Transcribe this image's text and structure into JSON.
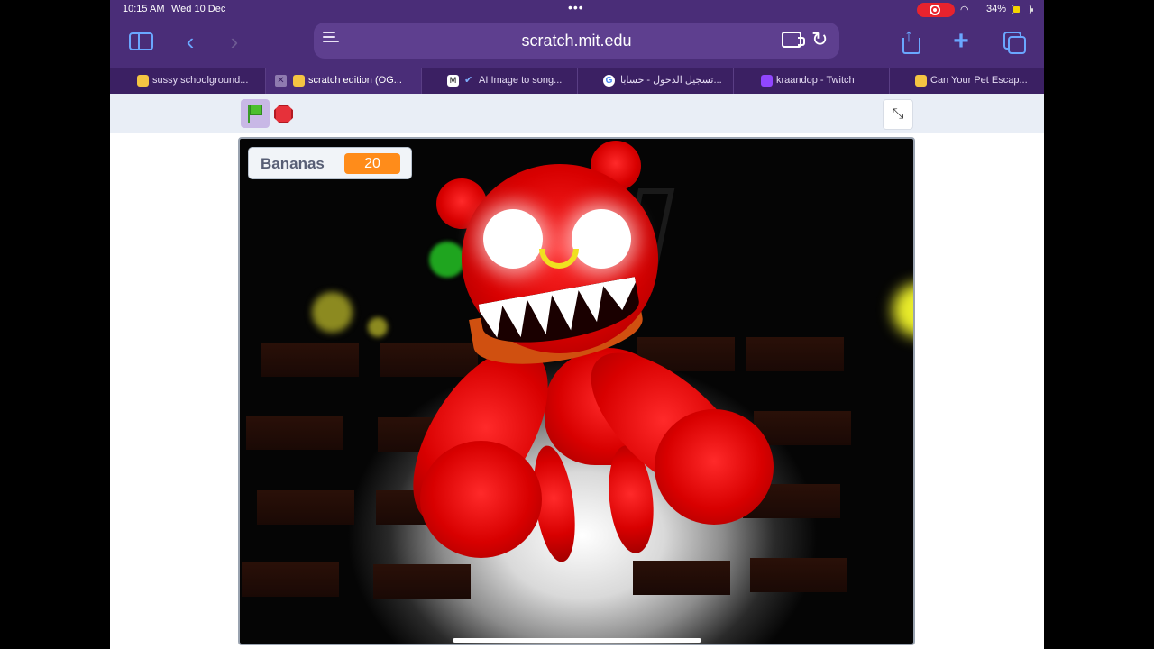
{
  "status_bar": {
    "time": "10:15 AM",
    "date": "Wed 10 Dec",
    "battery_percent": "34%",
    "battery_level": 0.34,
    "recording": true
  },
  "browser": {
    "url": "scratch.mit.edu",
    "tabs": [
      {
        "label": "sussy schoolground...",
        "active": false,
        "favicon_color": "#f5c542"
      },
      {
        "label": "scratch edition (OG...",
        "active": true,
        "favicon_color": "#f5c542"
      },
      {
        "label": "AI Image to song...",
        "active": false,
        "favicon_color": "#ffffff"
      },
      {
        "label": "تسجيل الدخول - حسابا...",
        "active": false,
        "favicon_color": "#ffffff"
      },
      {
        "label": "kraandop - Twitch",
        "active": false,
        "favicon_color": "#9146ff"
      },
      {
        "label": "Can Your Pet Escap...",
        "active": false,
        "favicon_color": "#f5c542"
      }
    ],
    "icons": {
      "sidebar": "sidebar-icon",
      "back": "chevron-left-icon",
      "forward": "chevron-right-icon",
      "share": "share-icon",
      "new_tab": "plus-icon",
      "tabs": "tabs-overview-icon"
    }
  },
  "player": {
    "green_flag": "green-flag-icon",
    "stop": "stop-sign-icon",
    "fullscreen": "exit-fullscreen-icon",
    "monitor": {
      "label": "Bananas",
      "value": "20"
    }
  },
  "colors": {
    "browser_chrome": "#4a2d78",
    "tab_strip": "#3b2063",
    "accent": "#6aa7ff",
    "monitor_value_bg": "#ff8c1a",
    "monster_red": "#e00000"
  }
}
